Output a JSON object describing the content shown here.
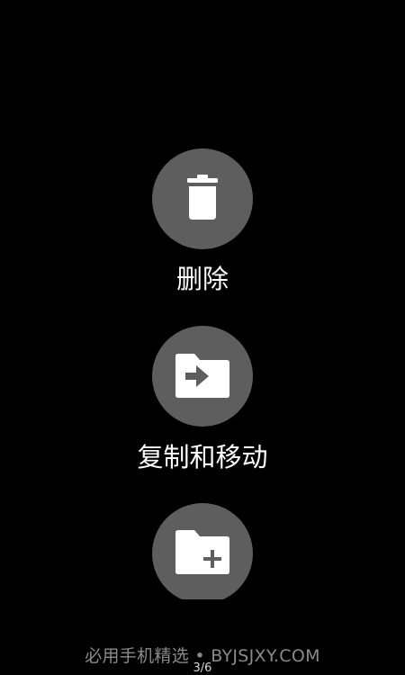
{
  "actions": [
    {
      "label": "删除",
      "icon": "trash-icon"
    },
    {
      "label": "复制和移动",
      "icon": "folder-move-icon"
    },
    {
      "label": "",
      "icon": "folder-add-icon"
    }
  ],
  "watermark": "必用手机精选 • BYJSJXY.COM",
  "page_indicator": "3/6",
  "colors": {
    "background": "#000000",
    "circle": "#5e5e5e",
    "icon": "#ffffff",
    "label": "#ffffff"
  }
}
